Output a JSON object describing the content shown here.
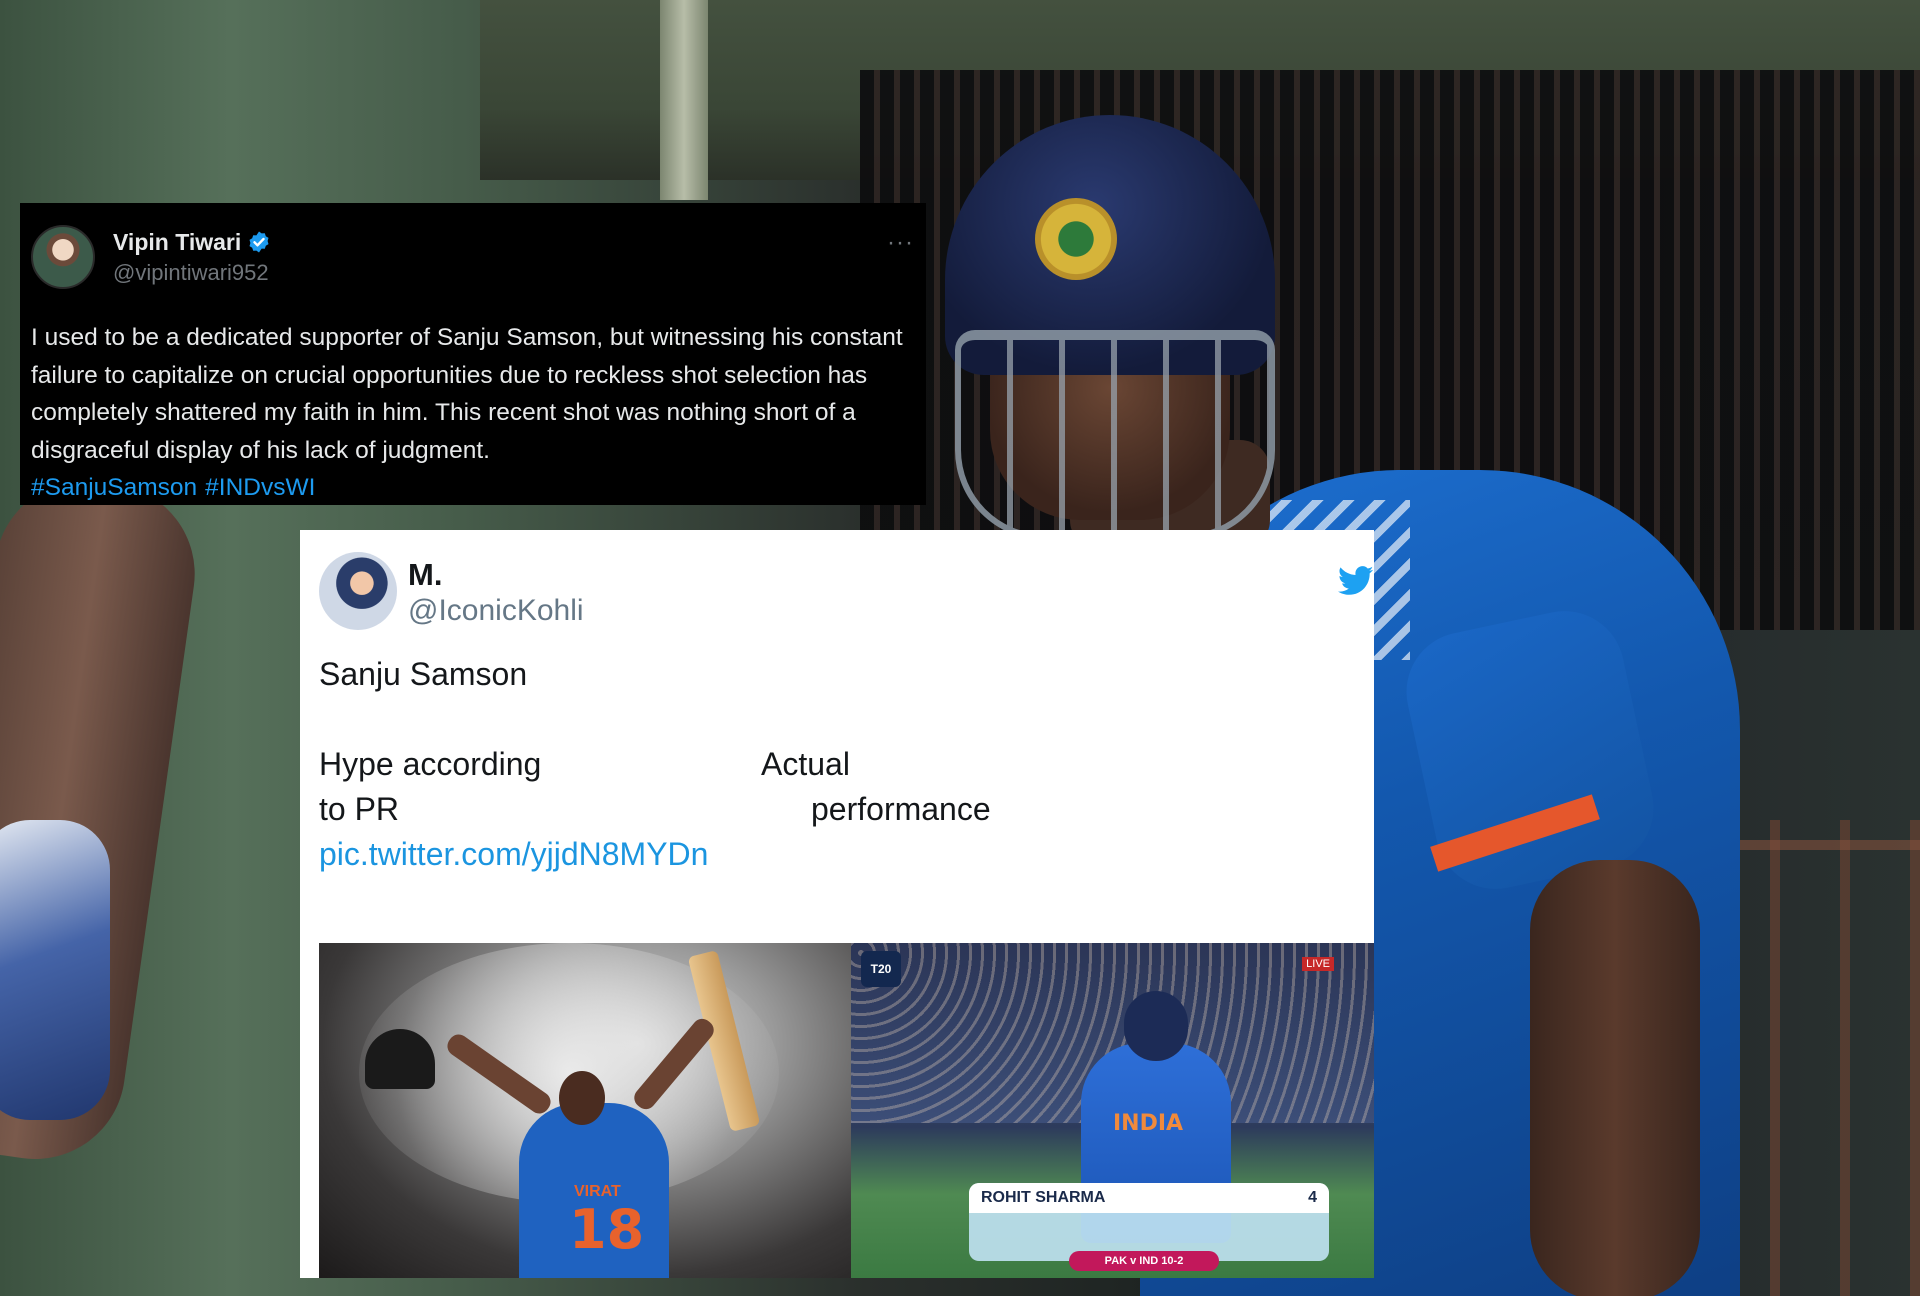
{
  "tweet_dark": {
    "display_name": "Vipin Tiwari",
    "handle": "@vipintiwari952",
    "more": "···",
    "text": "I used to be a dedicated supporter of Sanju Samson, but witnessing his constant failure to capitalize on crucial opportunities due to reckless shot selection has completely shattered my faith in him. This recent shot was nothing short of a disgraceful display of his lack of judgment.",
    "hashtags": [
      "#SanjuSamson",
      "#INDvsWI"
    ],
    "colors": {
      "background": "#000000",
      "text": "#e7e9ea",
      "handle": "#71767b",
      "link": "#1d9bf0",
      "verified": "#1d9bf0"
    },
    "icons": [
      "verified-badge-icon",
      "more-icon"
    ]
  },
  "tweet_light": {
    "display_name": "M.",
    "handle": "@IconicKohli",
    "line1": "Sanju Samson",
    "hype_label_1": "Hype according",
    "hype_label_2": "to PR",
    "actual_label_1": "Actual",
    "actual_label_2": "performance",
    "link": "pic.twitter.com/yjjdN8MYDn",
    "colors": {
      "background": "#ffffff",
      "text": "#14171a",
      "handle": "#657786",
      "link": "#1b95e0",
      "bird": "#1da1f2"
    },
    "icons": [
      "twitter-bird-icon"
    ],
    "media": {
      "left": {
        "jersey_name": "VIRAT",
        "jersey_number": "18"
      },
      "right": {
        "shirt_text": "INDIA",
        "scorecard_name": "ROHIT SHARMA",
        "scorecard_runs": "4",
        "scorecard_summary": "PAK v IND  10-2",
        "logo": "T20",
        "live": "LIVE"
      }
    }
  }
}
